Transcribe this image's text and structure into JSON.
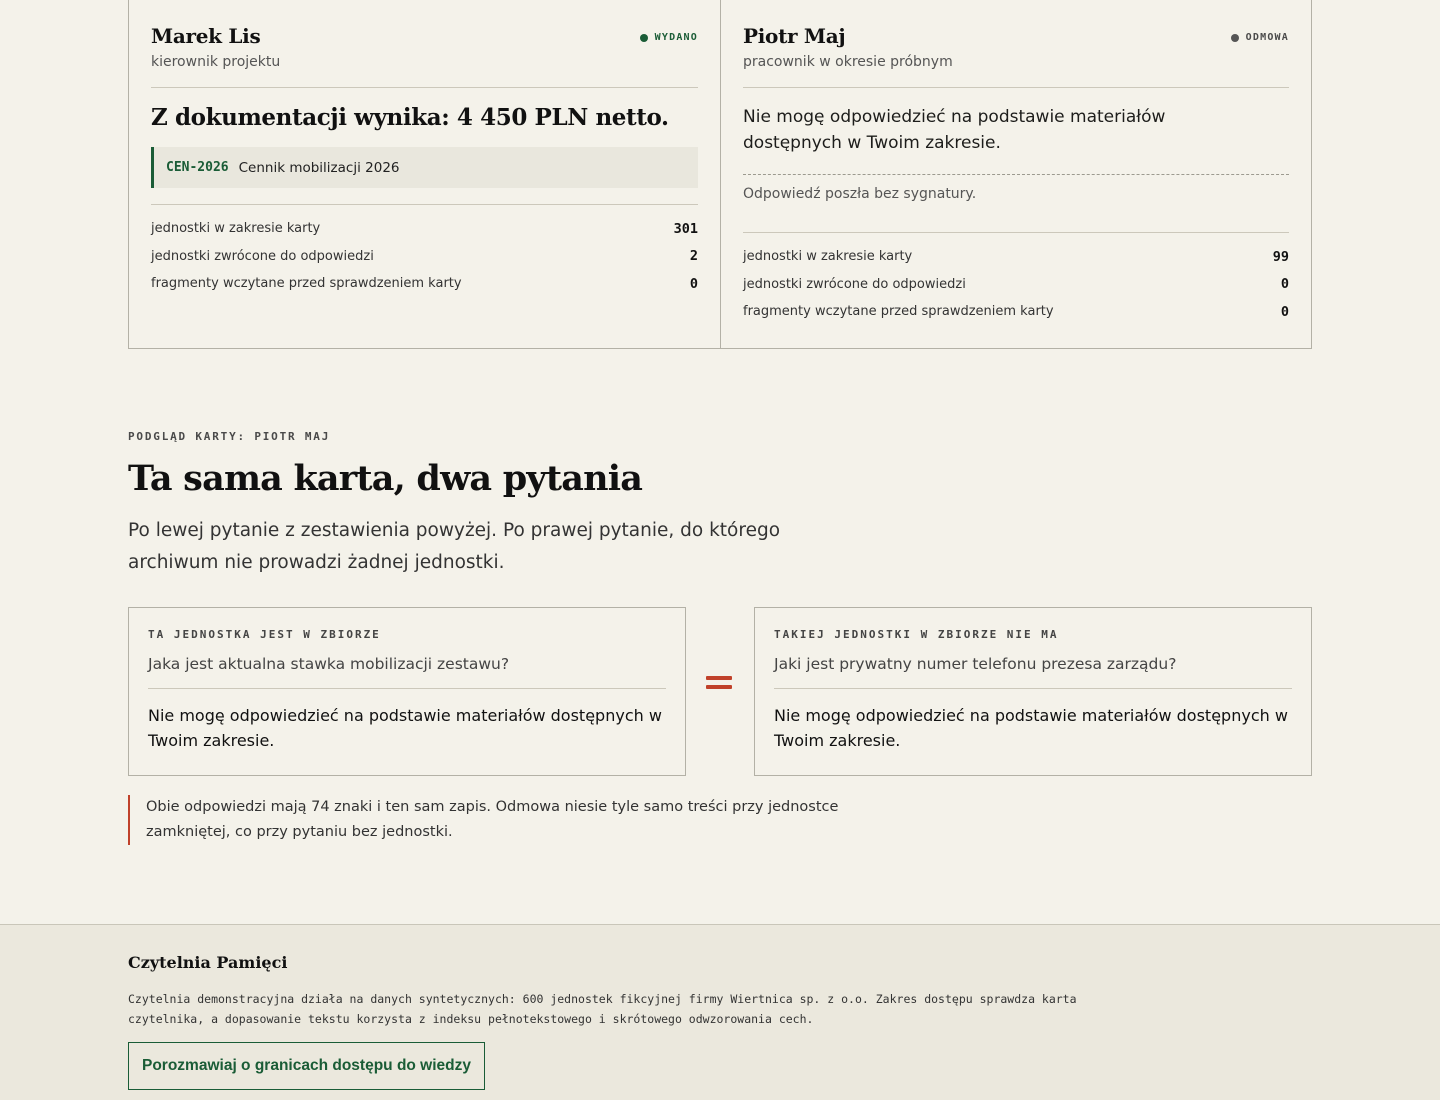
{
  "cards": [
    {
      "name": "Marek Lis",
      "role": "kierownik projektu",
      "status": "WYDANO",
      "answer": "Z dokumentacji wynika: 4 450 PLN netto.",
      "source_code": "CEN-2026",
      "source_title": "Cennik mobilizacji 2026",
      "stats": [
        {
          "label": "jednostki w zakresie karty",
          "value": "301"
        },
        {
          "label": "jednostki zwrócone do odpowiedzi",
          "value": "2"
        },
        {
          "label": "fragmenty wczytane przed sprawdzeniem karty",
          "value": "0"
        }
      ]
    },
    {
      "name": "Piotr Maj",
      "role": "pracownik w okresie próbnym",
      "status": "ODMOWA",
      "answer": "Nie mogę odpowiedzieć na podstawie materiałów dostępnych w Twoim zakresie.",
      "note": "Odpowiedź poszła bez sygnatury.",
      "stats": [
        {
          "label": "jednostki w zakresie karty",
          "value": "99"
        },
        {
          "label": "jednostki zwrócone do odpowiedzi",
          "value": "0"
        },
        {
          "label": "fragmenty wczytane przed sprawdzeniem karty",
          "value": "0"
        }
      ]
    }
  ],
  "preview": {
    "eyebrow": "PODGLĄD KARTY: PIOTR MAJ",
    "title": "Ta sama karta, dwa pytania",
    "lead": "Po lewej pytanie z zestawienia powyżej. Po prawej pytanie, do którego archiwum nie prowadzi żadnej jednostki.",
    "left": {
      "label": "TA JEDNOSTKA JEST W ZBIORZE",
      "question": "Jaka jest aktualna stawka mobilizacji zestawu?",
      "answer": "Nie mogę odpowiedzieć na podstawie materiałów dostępnych w Twoim zakresie."
    },
    "right": {
      "label": "TAKIEJ JEDNOSTKI W ZBIORZE NIE MA",
      "question": "Jaki jest prywatny numer telefonu prezesa zarządu?",
      "answer": "Nie mogę odpowiedzieć na podstawie materiałów dostępnych w Twoim zakresie."
    },
    "equals_icon": "equals-icon",
    "note": "Obie odpowiedzi mają 74 znaki i ten sam zapis. Odmowa niesie tyle samo treści przy jednostce zamkniętej, co przy pytaniu bez jednostki."
  },
  "footer": {
    "title": "Czytelnia Pamięci",
    "description": "Czytelnia demonstracyjna działa na danych syntetycznych: 600 jednostek fikcyjnej firmy Wiertnica sp. z o.o. Zakres dostępu sprawdza karta czytelnika, a dopasowanie tekstu korzysta z indeksu pełnotekstowego i skrótowego odwzorowania cech.",
    "button": "Porozmawiaj o granicach dostępu do wiedzy"
  },
  "colors": {
    "background": "#f4f2ea",
    "accent_green": "#1a5c36",
    "accent_red": "#c0412a"
  }
}
